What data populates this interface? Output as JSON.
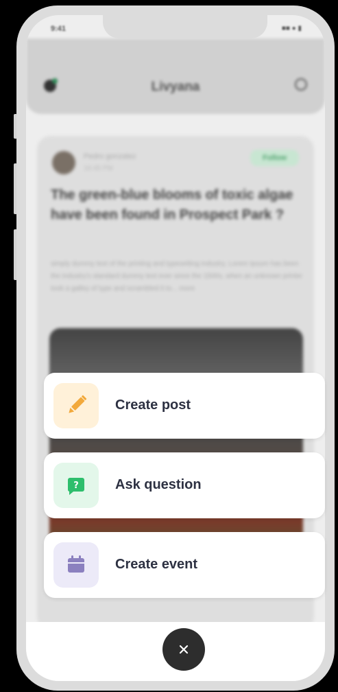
{
  "status_bar": {
    "time": "9:41",
    "icons": "■■ ● ▮"
  },
  "header": {
    "title": "Livyana",
    "logo_icon": "app-logo-icon",
    "search_icon": "search-icon"
  },
  "feed": {
    "author_name": "Pedro gonzalez",
    "post_time": "16:45 PM",
    "follow_label": "Follow",
    "title": "The green-blue blooms of toxic algae have been found in Prospect Park ?",
    "body": "simply dummy text of the printing and typesetting industry. Lorem Ipsum has been the industry's standard dummy text ever since the 1500s, when an unknown printer took a galley of type and scrambled it to... more"
  },
  "action_menu": {
    "items": [
      {
        "label": "Create post",
        "icon": "pencil-icon",
        "icon_bg": "#FFF1D9",
        "icon_color": "#F2A93B"
      },
      {
        "label": "Ask question",
        "icon": "question-chat-icon",
        "icon_bg": "#E3F7EA",
        "icon_color": "#2DBE6C"
      },
      {
        "label": "Create event",
        "icon": "calendar-icon",
        "icon_bg": "#ECEAF8",
        "icon_color": "#8B80BF"
      }
    ]
  },
  "close_button": {
    "icon": "close-icon"
  }
}
